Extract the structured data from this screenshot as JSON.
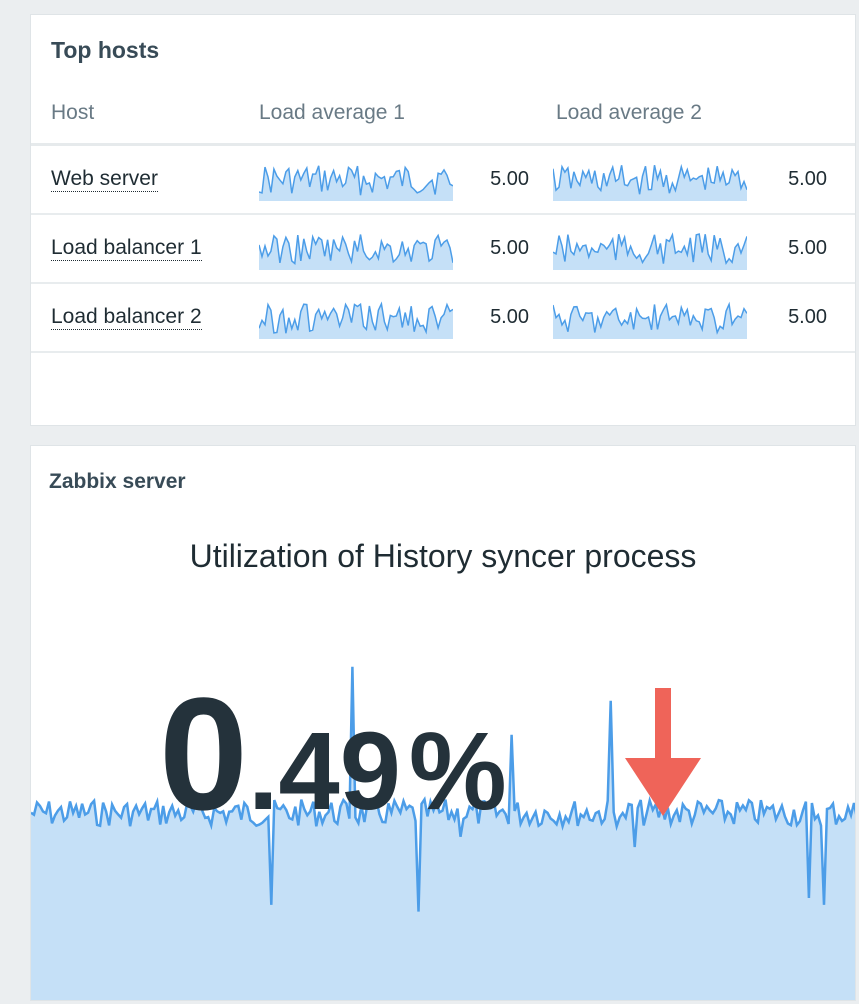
{
  "top_hosts": {
    "title": "Top hosts",
    "columns": [
      "Host",
      "Load average 1",
      "Load average 2"
    ],
    "rows": [
      {
        "host": "Web server",
        "load1": "5.00",
        "load2": "5.00"
      },
      {
        "host": "Load balancer 1",
        "load1": "5.00",
        "load2": "5.00"
      },
      {
        "host": "Load balancer 2",
        "load1": "5.00",
        "load2": "5.00"
      }
    ],
    "sparkline_color": "#4c9de8",
    "sparkline_fill": "#c5e0f7"
  },
  "item_widget": {
    "title": "Zabbix server",
    "description": "Utilization of History syncer process",
    "value_int": "0",
    "value_dec": ".49",
    "units": "%",
    "trend": "down",
    "trend_color": "#ef6459",
    "trend_icon": "arrow-down-icon"
  }
}
